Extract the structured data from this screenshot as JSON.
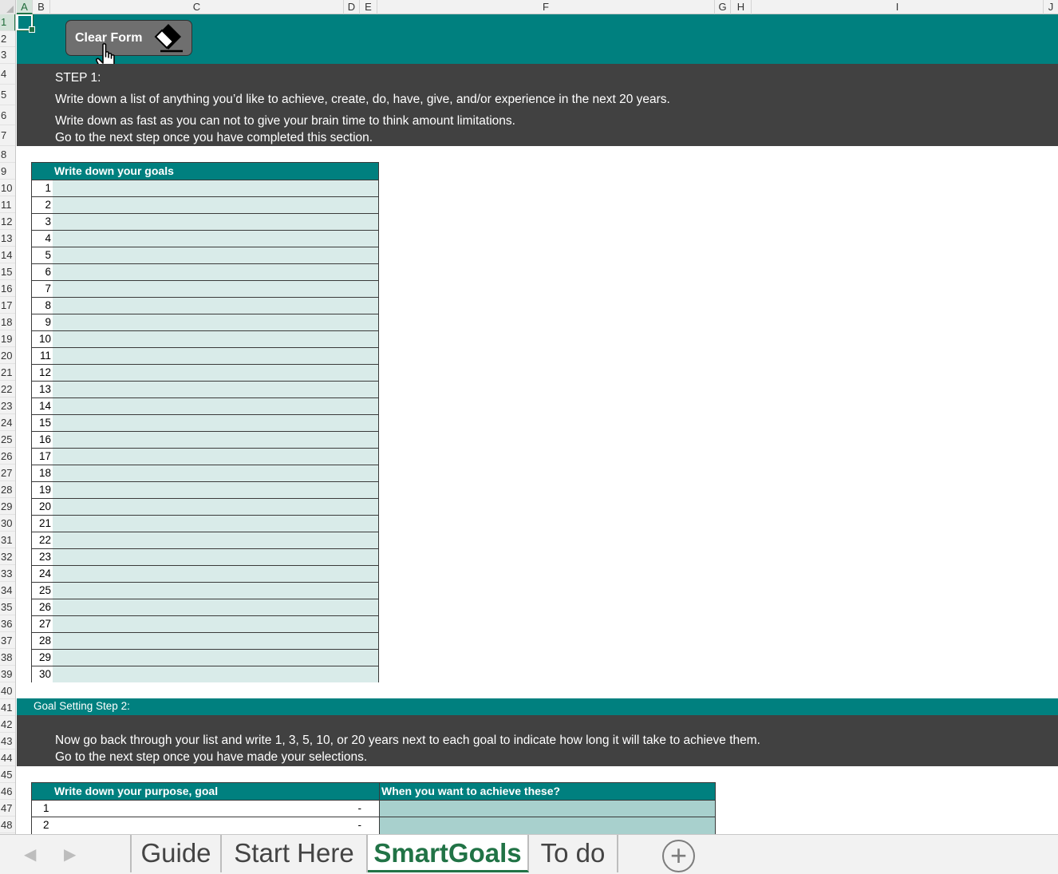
{
  "columns": [
    "A",
    "B",
    "C",
    "D",
    "E",
    "F",
    "G",
    "H",
    "I",
    "J"
  ],
  "rows": [
    "1",
    "2",
    "3",
    "4",
    "5",
    "6",
    "7",
    "8",
    "9",
    "10",
    "11",
    "12",
    "13",
    "14",
    "15",
    "16",
    "17",
    "18",
    "19",
    "20",
    "21",
    "22",
    "23",
    "24",
    "25",
    "26",
    "27",
    "28",
    "29",
    "30",
    "31",
    "32",
    "33",
    "34",
    "35",
    "36",
    "37",
    "38",
    "39",
    "40",
    "41",
    "42",
    "43",
    "44",
    "45",
    "46",
    "47",
    "48"
  ],
  "button": {
    "label": "Clear Form"
  },
  "step1": {
    "title": "STEP 1:",
    "line1": "Write down a list of anything you’d like to achieve, create, do, have, give, and/or experience in the next 20 years.",
    "line2": "Write down as fast as you can not to give your brain time to think amount limitations.",
    "line3": "Go to the next step once you have completed this section."
  },
  "goals_table": {
    "header": "Write down your goals",
    "numbers": [
      "1",
      "2",
      "3",
      "4",
      "5",
      "6",
      "7",
      "8",
      "9",
      "10",
      "11",
      "12",
      "13",
      "14",
      "15",
      "16",
      "17",
      "18",
      "19",
      "20",
      "21",
      "22",
      "23",
      "24",
      "25",
      "26",
      "27",
      "28",
      "29",
      "30"
    ]
  },
  "step2": {
    "title": "Goal Setting Step 2:",
    "line1": "Now go back through your list and write 1, 3, 5, 10, or 20 years next to each goal to indicate how long it will take to achieve them.",
    "line2": "Go to the next step once you have made your selections."
  },
  "purpose_table": {
    "header_left": "Write down your purpose, goal",
    "header_right": "When you want to achieve these?",
    "rows": [
      {
        "num": "1",
        "value": "-"
      },
      {
        "num": "2",
        "value": "-"
      }
    ]
  },
  "tabs": [
    {
      "label": "Guide",
      "active": false
    },
    {
      "label": "Start Here",
      "active": false
    },
    {
      "label": "SmartGoals",
      "active": true
    },
    {
      "label": "To do",
      "active": false
    }
  ],
  "add_sheet": "+",
  "colors": {
    "teal": "#00807f",
    "dark": "#414141",
    "cell_fill": "#d9ebe9",
    "cell_fill2": "#a8d0cd",
    "excel_green": "#217346"
  }
}
